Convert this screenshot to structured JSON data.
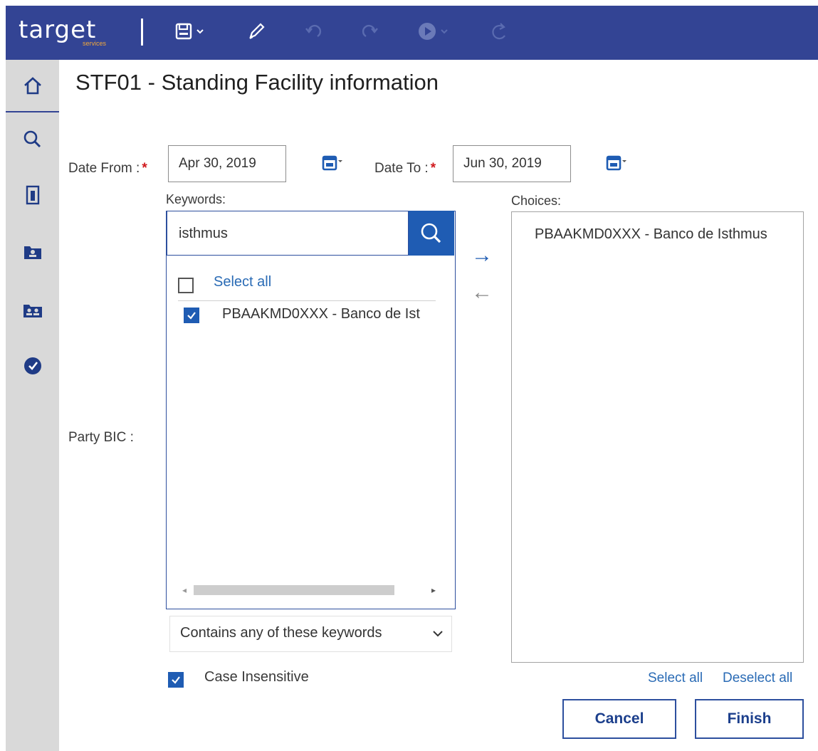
{
  "app": {
    "logo_text": "target",
    "logo_sub": "services",
    "brand_color": "#334494",
    "accent_color": "#1f5cb3"
  },
  "toolbar": {
    "icons": [
      "save-icon",
      "chevron-down-icon",
      "edit-icon",
      "undo-icon",
      "redo-icon",
      "play-icon",
      "chevron-down-icon",
      "refresh-icon"
    ]
  },
  "nav": {
    "items": [
      "home-icon",
      "search-icon",
      "report-icon",
      "folder-user-icon",
      "folder-users-icon",
      "check-circle-icon"
    ]
  },
  "page": {
    "title": "STF01 - Standing Facility information"
  },
  "filters": {
    "date_from_label": "Date From :",
    "date_from_value": "Apr 30, 2019",
    "date_to_label": "Date To :",
    "date_to_value": "Jun 30, 2019",
    "required_marker": "*",
    "party_bic_label": "Party BIC  :"
  },
  "keywords": {
    "label": "Keywords:",
    "value": "isthmus",
    "select_all": "Select all",
    "results": [
      {
        "text": "PBAAKMD0XXX - Banco de Ist",
        "checked": true
      }
    ],
    "match_mode": "Contains any of these keywords"
  },
  "choices": {
    "label": "Choices:",
    "items": [
      "PBAAKMD0XXX - Banco de Isthmus"
    ],
    "select_all": "Select all",
    "deselect_all": "Deselect all"
  },
  "options": {
    "case_insensitive_label": "Case Insensitive",
    "case_insensitive_checked": true
  },
  "buttons": {
    "cancel": "Cancel",
    "finish": "Finish"
  }
}
